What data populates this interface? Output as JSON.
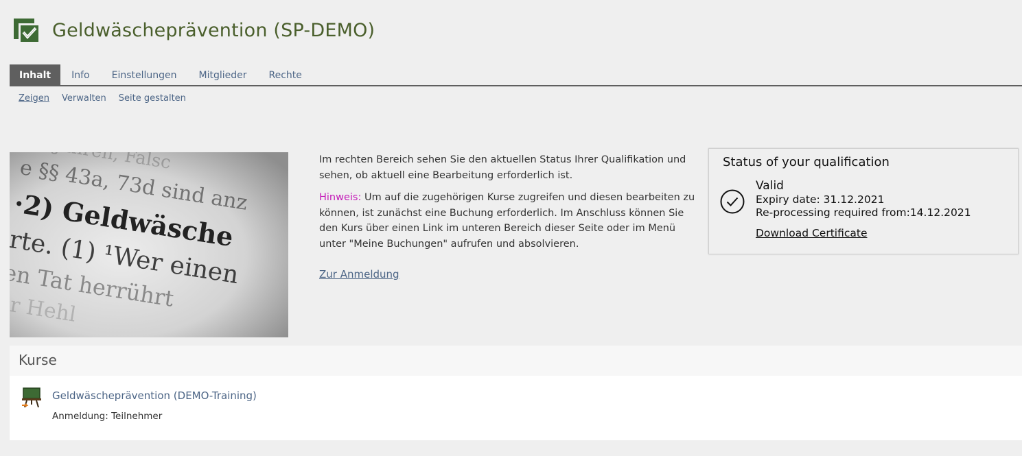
{
  "header": {
    "title": "Geldwäscheprävention (SP-DEMO)",
    "icon": "checklist-icon"
  },
  "tabs": [
    {
      "label": "Inhalt",
      "active": true
    },
    {
      "label": "Info"
    },
    {
      "label": "Einstellungen"
    },
    {
      "label": "Mitglieder"
    },
    {
      "label": "Rechte"
    }
  ],
  "subtabs": [
    {
      "label": "Zeigen",
      "active": true
    },
    {
      "label": "Verwalten"
    },
    {
      "label": "Seite gestalten"
    }
  ],
  "hero_image": {
    "lines": [
      "e §§ 43a, 73d sind anz",
      "·2)   Geldwäsche",
      "erte. (1) ¹Wer einen",
      "gen Tat herrührt"
    ]
  },
  "intro": {
    "paragraph1": "Im rechten Bereich sehen Sie den aktuellen Status Ihrer Qualifikation und sehen, ob aktuell eine Bearbeitung erforderlich ist.",
    "hint_label": "Hinweis:",
    "paragraph2": " Um auf die zugehörigen Kurse zugreifen und diesen bearbeiten zu können, ist zunächst eine Buchung erforderlich. Im Anschluss können Sie den Kurs über einen Link im unteren Bereich dieser Seite oder im Menü unter \"Meine Buchungen\" aufrufen und absolvieren.",
    "register_link": "Zur Anmeldung"
  },
  "status": {
    "title": "Status of your qualification",
    "state": "Valid",
    "expiry": "Expiry date: 31.12.2021",
    "reprocessing": "Re-processing required from:14.12.2021",
    "download": "Download Certificate",
    "icon": "check-circle-icon"
  },
  "courses": {
    "heading": "Kurse",
    "items": [
      {
        "title": "Geldwäscheprävention (DEMO-Training)",
        "meta": "Anmeldung: Teilnehmer",
        "icon": "course-icon"
      }
    ]
  },
  "colors": {
    "title_green": "#4a5f2c",
    "link_blue": "#4c6586",
    "hint_magenta": "#c419b8",
    "tab_active_bg": "#5f5f5f"
  }
}
